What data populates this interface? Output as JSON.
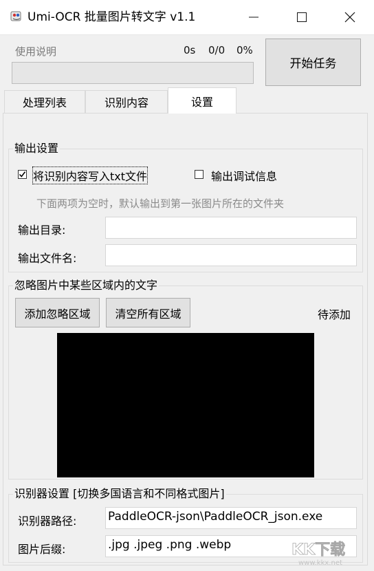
{
  "window": {
    "title": "Umi-OCR 批量图片转文字 v1.1",
    "controls": [
      "minimize-icon",
      "maximize-icon",
      "close-icon"
    ]
  },
  "top": {
    "help_link": "使用说明",
    "time": "0s",
    "count": "0/0",
    "percent": "0%",
    "progress_value": 0,
    "start_button": "开始任务"
  },
  "tabs": [
    {
      "label": "处理列表",
      "active": false
    },
    {
      "label": "识别内容",
      "active": false
    },
    {
      "label": "设置",
      "active": true
    }
  ],
  "output": {
    "group_title": "输出设置",
    "write_txt_label": "将识别内容写入txt文件",
    "write_txt_checked": true,
    "debug_label": "输出调试信息",
    "debug_checked": false,
    "hint": "下面两项为空时，默认输出到第一张图片所在的文件夹",
    "dir_label": "输出目录:",
    "dir_value": "",
    "filename_label": "输出文件名:",
    "filename_value": ""
  },
  "ignore": {
    "group_title": "忽略图片中某些区域内的文字",
    "add_button": "添加忽略区域",
    "clear_button": "清空所有区域",
    "status": "待添加"
  },
  "recognizer": {
    "group_title": "识别器设置 [切换多国语言和不同格式图片]",
    "path_label": "识别器路径:",
    "path_value": "PaddleOCR-json\\PaddleOCR_json.exe",
    "suffix_label": "图片后缀:",
    "suffix_value": ".jpg .jpeg .png .webp"
  },
  "watermark": {
    "text": "KK下载",
    "subtext": "www.kkx.net"
  },
  "colors": {
    "window_bg": "#f0f0f0",
    "titlebar_bg": "#ffffff",
    "canvas_bg": "#000000",
    "progress_fill": "#06b025"
  }
}
